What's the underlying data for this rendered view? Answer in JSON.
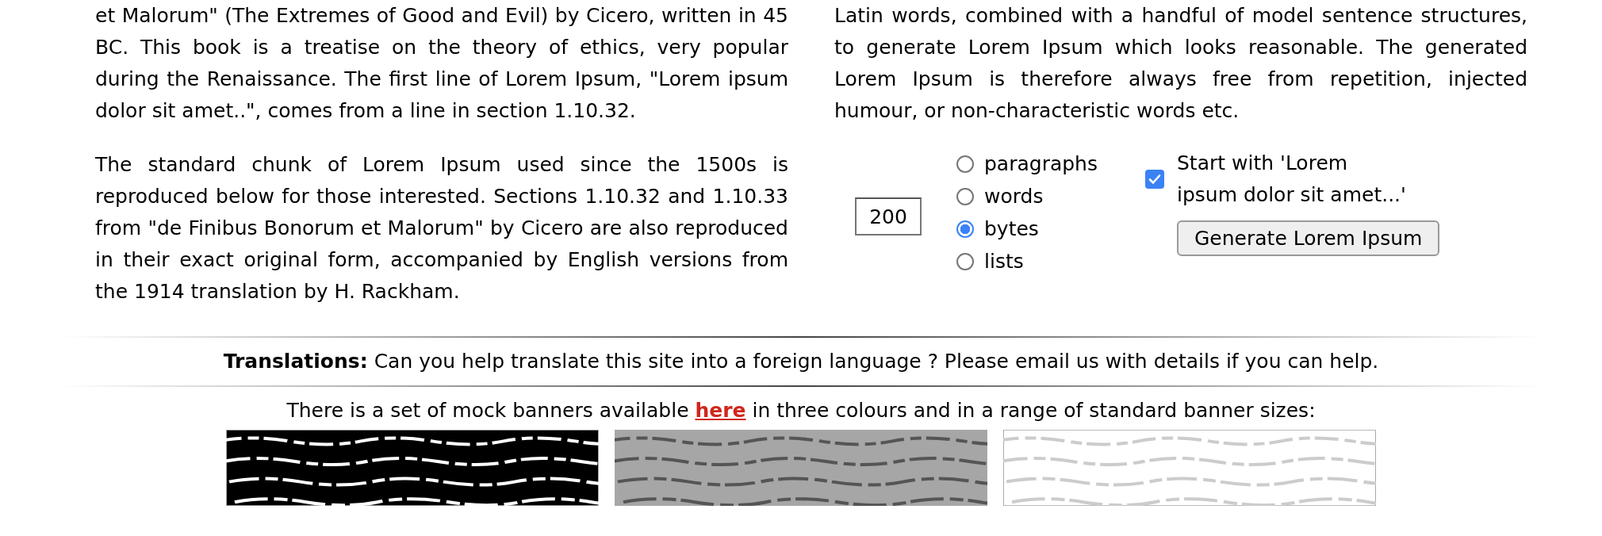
{
  "left_column": {
    "paragraphs": [
      "et Malorum\" (The Extremes of Good and Evil) by Cicero, written in 45 BC. This book is a treatise on the theory of ethics, very popular during the Renaissance. The first line of Lorem Ipsum, \"Lorem ipsum dolor sit amet..\", comes from a line in section 1.10.32.",
      "The standard chunk of Lorem Ipsum used since the 1500s is reproduced below for those interested. Sections 1.10.32 and 1.10.33 from \"de Finibus Bonorum et Malorum\" by Cicero are also reproduced in their exact original form, accompanied by English versions from the 1914 translation by H. Rackham."
    ]
  },
  "right_column": {
    "paragraph": "Latin words, combined with a handful of model sentence structures, to generate Lorem Ipsum which looks reasonable. The generated Lorem Ipsum is therefore always free from repetition, injected humour, or non-characteristic words etc.",
    "generator": {
      "amount": {
        "value": "200"
      },
      "units": [
        {
          "label": "paragraphs",
          "selected": false
        },
        {
          "label": "words",
          "selected": false
        },
        {
          "label": "bytes",
          "selected": true
        },
        {
          "label": "lists",
          "selected": false
        }
      ],
      "start_with": {
        "label": "Start with 'Lorem ipsum dolor sit amet...'",
        "checked": true
      },
      "button": "Generate Lorem Ipsum"
    }
  },
  "translations": "**Translations:** Can you help translate this site into a foreign language ? Please email us with details if you can help.",
  "banners": {
    "text_before": "There is a set of mock banners available ",
    "link": "here",
    "text_after": " in three colours and in a range of standard banner sizes:"
  }
}
